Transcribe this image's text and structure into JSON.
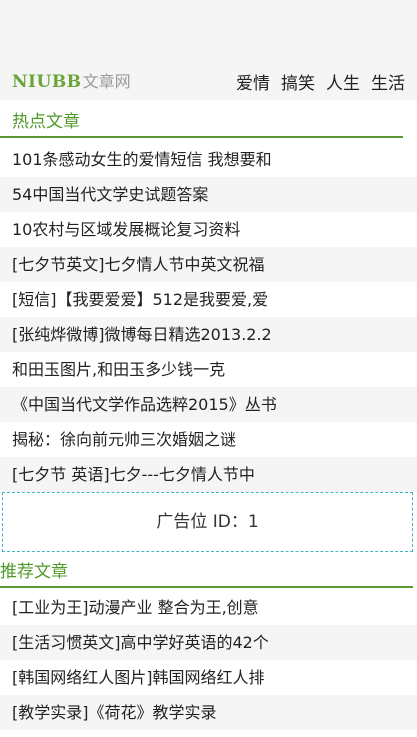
{
  "header": {
    "logo_mark": "NIUBB",
    "logo_text": "文章网",
    "nav": [
      "爱情",
      "搞笑",
      "人生",
      "生活"
    ]
  },
  "hot": {
    "title": "热点文章",
    "items": [
      "101条感动女生的爱情短信 我想要和",
      "54中国当代文学史试题答案",
      "10农村与区域发展概论复习资料",
      "[七夕节英文]七夕情人节中英文祝福",
      "[短信]【我要爱爱】512是我要爱,爱",
      "[张纯烨微博]微博每日精选2013.2.2",
      "和田玉图片,和田玉多少钱一克",
      "《中国当代文学作品选粹2015》丛书",
      "揭秘：徐向前元帅三次婚姻之谜",
      "[七夕节 英语]七夕---七夕情人节中"
    ]
  },
  "ad": {
    "label": "广告位 ID：1"
  },
  "recommended": {
    "title": "推荐文章",
    "items": [
      "[工业为王]动漫产业 整合为王,创意",
      "[生活习惯英文]高中学好英语的42个",
      "[韩国网络红人图片]韩国网络红人排",
      "[教学实录]《荷花》教学实录"
    ]
  }
}
